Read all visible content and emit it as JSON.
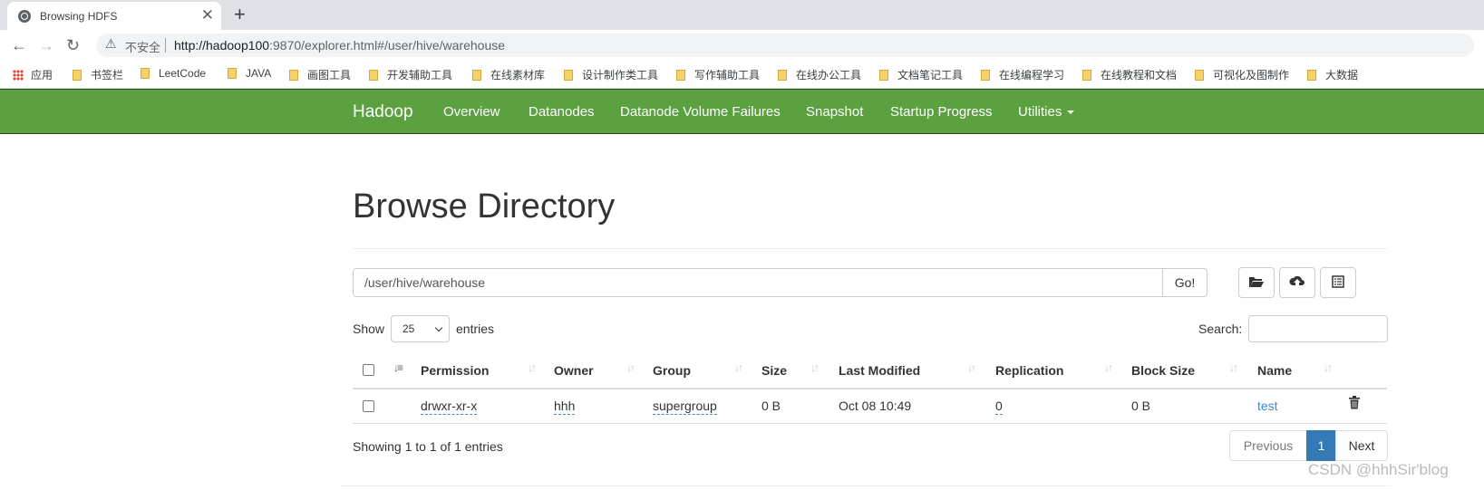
{
  "browser": {
    "tab_title": "Browsing HDFS",
    "tab_close": "✕",
    "new_tab": "+",
    "insecure_label": "不安全",
    "url_host": "http://hadoop100",
    "url_rest": ":9870/explorer.html#/user/hive/warehouse"
  },
  "bookmarks": [
    {
      "label": "应用",
      "icon": "apps-grid-icon"
    },
    {
      "label": "书签栏"
    },
    {
      "label": "LeetCode"
    },
    {
      "label": "JAVA"
    },
    {
      "label": "画图工具"
    },
    {
      "label": "开发辅助工具"
    },
    {
      "label": "在线素材库"
    },
    {
      "label": "设计制作类工具"
    },
    {
      "label": "写作辅助工具"
    },
    {
      "label": "在线办公工具"
    },
    {
      "label": "文档笔记工具"
    },
    {
      "label": "在线编程学习"
    },
    {
      "label": "在线教程和文档"
    },
    {
      "label": "可视化及图制作"
    },
    {
      "label": "大数据"
    }
  ],
  "navbar": {
    "brand": "Hadoop",
    "links": [
      "Overview",
      "Datanodes",
      "Datanode Volume Failures",
      "Snapshot",
      "Startup Progress",
      "Utilities"
    ],
    "color": "#5ba13f"
  },
  "main": {
    "title": "Browse Directory",
    "path_value": "/user/hive/warehouse",
    "go_label": "Go!",
    "show_label": "Show",
    "entries_value": "25",
    "entries_label": "entries",
    "search_label": "Search:",
    "search_value": ""
  },
  "table": {
    "columns": [
      "Permission",
      "Owner",
      "Group",
      "Size",
      "Last Modified",
      "Replication",
      "Block Size",
      "Name"
    ],
    "rows": [
      {
        "permission": "drwxr-xr-x",
        "owner": "hhh",
        "group": "supergroup",
        "size": "0 B",
        "last_modified": "Oct 08 10:49",
        "replication": "0",
        "block_size": "0 B",
        "name": "test"
      }
    ],
    "info": "Showing 1 to 1 of 1 entries"
  },
  "pagination": {
    "previous": "Previous",
    "current": "1",
    "next": "Next",
    "active_color": "#337ab7"
  },
  "watermark": "CSDN @hhhSir'blog"
}
